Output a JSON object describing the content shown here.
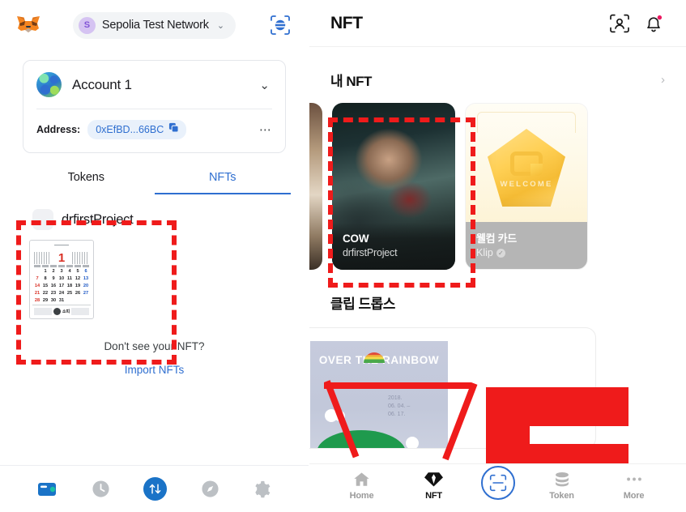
{
  "metamask": {
    "logo_icon": "metamask-fox-icon",
    "network": {
      "avatar_letter": "S",
      "name": "Sepolia Test Network",
      "chevron": "⌄"
    },
    "scan_icon": "qr-scan-icon",
    "account": {
      "name": "Account 1",
      "chevron": "⌄"
    },
    "address": {
      "label": "Address:",
      "value": "0xEfBD...66BC",
      "copy_icon": "copy-icon",
      "more_icon": "⋯"
    },
    "tabs": [
      {
        "label": "Tokens",
        "active": false
      },
      {
        "label": "NFTs",
        "active": true
      }
    ],
    "collection": {
      "chevron": "⌄",
      "name": "drfirstProject"
    },
    "nft_thumb": {
      "name": "calendar-nft-thumbnail",
      "month": "1",
      "weeks": [
        [
          "",
          "1",
          "2",
          "3",
          "4",
          "5",
          "6"
        ],
        [
          "7",
          "8",
          "9",
          "10",
          "11",
          "12",
          "13"
        ],
        [
          "14",
          "15",
          "16",
          "17",
          "18",
          "19",
          "20"
        ],
        [
          "21",
          "22",
          "23",
          "24",
          "25",
          "26",
          "27"
        ],
        [
          "28",
          "29",
          "30",
          "31",
          "",
          "",
          ""
        ]
      ],
      "footer_text": "소띠"
    },
    "empty": {
      "question": "Don't see your NFT?",
      "link": "Import NFTs"
    },
    "bottom_nav": [
      {
        "name": "wallet",
        "icon": "wallet-icon",
        "active": true
      },
      {
        "name": "history",
        "icon": "clock-icon",
        "active": false
      },
      {
        "name": "swap",
        "icon": "swap-arrows-icon",
        "active": true
      },
      {
        "name": "browser",
        "icon": "compass-icon",
        "active": false
      },
      {
        "name": "settings",
        "icon": "gear-icon",
        "active": false
      }
    ]
  },
  "klip": {
    "header": {
      "title": "NFT",
      "profile_scan_icon": "profile-scan-icon",
      "bell_icon": "bell-icon",
      "bell_badge": true
    },
    "my_nft": {
      "title": "내 NFT",
      "chevron": "›"
    },
    "cards": [
      {
        "name": "COW",
        "sub": "drfirstProject",
        "kind": "photo"
      },
      {
        "name": "웰컴 카드",
        "sub": "Klip",
        "verified": true,
        "badge_word": "WELCOME",
        "kind": "welcome"
      }
    ],
    "drops": {
      "title": "클립 드롭스",
      "poster_title": "OVER THE RAINBOW",
      "poster_meta": "2018.\n06. 04. –\n06. 17."
    },
    "bottom_nav": [
      {
        "label": "Home",
        "icon": "home-icon",
        "active": false
      },
      {
        "label": "NFT",
        "icon": "diamond-icon",
        "active": true
      },
      {
        "label": "",
        "icon": "scan-icon",
        "active": false
      },
      {
        "label": "Token",
        "icon": "coins-icon",
        "active": false
      },
      {
        "label": "More",
        "icon": "more-dots-icon",
        "active": false
      }
    ]
  },
  "colors": {
    "accent_blue": "#2f6fd0",
    "annotation_red": "#ef1b1b",
    "klip_gold": "#ffd055"
  }
}
